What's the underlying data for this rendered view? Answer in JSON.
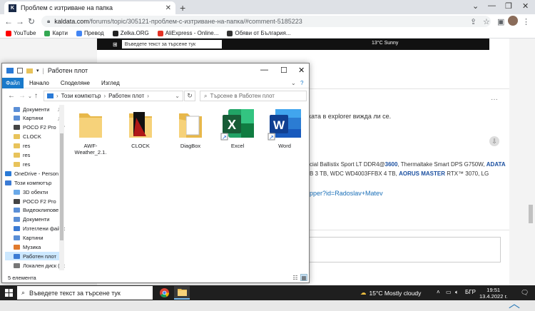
{
  "browser": {
    "tab_title": "Проблем с изтриване на папка",
    "tab_favicon": "K",
    "url_host": "kaldata.com",
    "url_path": "/forums/topic/305121-проблем-с-изтриване-на-папка/#comment-5185223",
    "bookmarks": [
      {
        "label": "YouTube",
        "color": "#ff0000"
      },
      {
        "label": "Карти",
        "color": "#34a853"
      },
      {
        "label": "Превод",
        "color": "#4285f4"
      },
      {
        "label": "Zelka.ORG",
        "color": "#222222"
      },
      {
        "label": "AliExpress - Online...",
        "color": "#e43225"
      },
      {
        "label": "Обяви от България...",
        "color": "#333333"
      }
    ]
  },
  "webpage": {
    "embed_search": "Въведете текст за търсене тук",
    "embed_weather": "13°C  Sunny",
    "post_text": "ката в explorer вижда ли се.",
    "sig_line1_pre": "cial Ballistix Sport LT DDR4@",
    "sig_line1_b1": "3600",
    "sig_line1_mid": ", Thermaltake Smart DPS G750W, ",
    "sig_line1_b2": "ADATA",
    "sig_line2_pre": "B 3 TB, WDC WD4003FFBX 4 TB, ",
    "sig_line2_b1": "AORUS MASTER",
    "sig_line2_mid": " RTX™ 3070, LG",
    "link_text": "pper?id=Radoslav+Matev",
    "more": "···"
  },
  "explorer": {
    "title": "Работен плот",
    "ribbon": [
      "Файл",
      "Начало",
      "Споделяне",
      "Изглед"
    ],
    "breadcrumb": [
      "Този компютър",
      "Работен плот"
    ],
    "search_placeholder": "Търсене в Работен плот",
    "nav": [
      {
        "label": "Документи",
        "color": "#5b8fd6",
        "pin": true
      },
      {
        "label": "Картини",
        "color": "#5b8fd6",
        "pin": true
      },
      {
        "label": "POCO F2 Pro",
        "color": "#444444",
        "pin": true
      },
      {
        "label": "CLOCK",
        "color": "#e8c35b",
        "pin": false
      },
      {
        "label": "res",
        "color": "#e8c35b",
        "pin": false
      },
      {
        "label": "res",
        "color": "#e8c35b",
        "pin": false
      },
      {
        "label": "res",
        "color": "#e8c35b",
        "pin": false
      },
      {
        "label": "OneDrive - Person",
        "color": "#2a7ad6",
        "pin": false
      },
      {
        "label": "Този компютър",
        "color": "#3b7bd4",
        "pin": false
      },
      {
        "label": "3D обекти",
        "color": "#6aa9e8",
        "pin": false
      },
      {
        "label": "POCO F2 Pro",
        "color": "#444444",
        "pin": false
      },
      {
        "label": "Видеоклипове",
        "color": "#5b8fd6",
        "pin": false
      },
      {
        "label": "Документи",
        "color": "#5b8fd6",
        "pin": false
      },
      {
        "label": "Изтеглени файлове",
        "color": "#3b7bd4",
        "pin": false
      },
      {
        "label": "Картини",
        "color": "#5b8fd6",
        "pin": false
      },
      {
        "label": "Музика",
        "color": "#e07a2e",
        "pin": false
      },
      {
        "label": "Работен плот",
        "color": "#3b7bd4",
        "pin": false,
        "selected": true
      },
      {
        "label": "Локален диск (C:)",
        "color": "#777777",
        "pin": false
      }
    ],
    "files": [
      {
        "label": "AWF-Weather_2.1.",
        "kind": "folder"
      },
      {
        "label": "CLOCK",
        "kind": "folder-clock"
      },
      {
        "label": "DiagBox",
        "kind": "folder-doc"
      },
      {
        "label": "Excel",
        "kind": "excel"
      },
      {
        "label": "Word",
        "kind": "word"
      }
    ],
    "status": "5 елемента"
  },
  "taskbar": {
    "search": "Въведете текст за търсене тук",
    "weather": "15°C  Mostly cloudy",
    "lang": "БГР",
    "time": "19:51",
    "date": "13.4.2022 г."
  }
}
